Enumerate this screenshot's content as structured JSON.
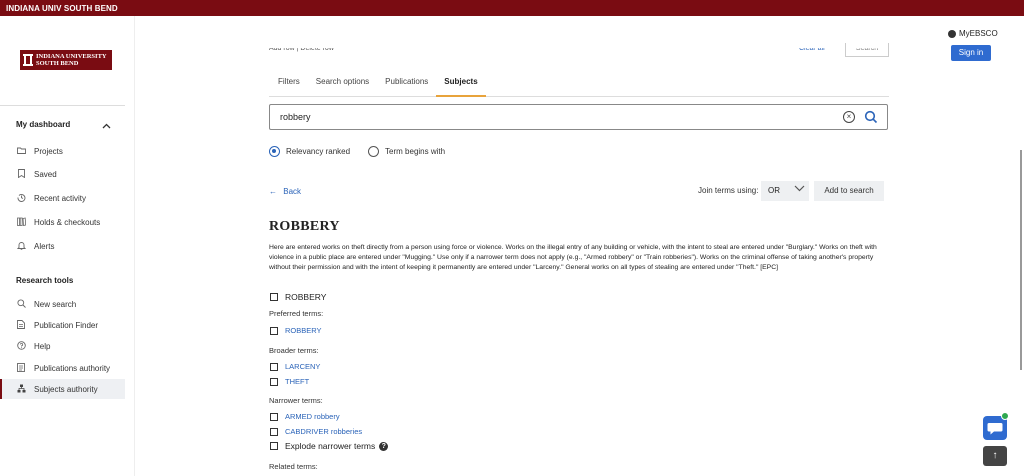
{
  "topbar": {
    "title": "INDIANA UNIV SOUTH BEND"
  },
  "logo": {
    "line1": "INDIANA UNIVERSITY",
    "line2": "SOUTH BEND"
  },
  "sidebar": {
    "dashboard_label": "My dashboard",
    "items": [
      {
        "label": "Projects",
        "icon": "folder-icon"
      },
      {
        "label": "Saved",
        "icon": "bookmark-icon"
      },
      {
        "label": "Recent activity",
        "icon": "history-icon"
      },
      {
        "label": "Holds & checkouts",
        "icon": "books-icon"
      },
      {
        "label": "Alerts",
        "icon": "bell-icon"
      }
    ],
    "research_label": "Research tools",
    "tools": [
      {
        "label": "New search",
        "icon": "search-icon"
      },
      {
        "label": "Publication Finder",
        "icon": "document-icon"
      },
      {
        "label": "Help",
        "icon": "help-icon"
      },
      {
        "label": "Publications authority",
        "icon": "list-icon"
      },
      {
        "label": "Subjects authority",
        "icon": "hierarchy-icon"
      }
    ]
  },
  "ghost": {
    "add_row": "Add row",
    "delete_row": "Delete row",
    "clear_all": "Clear all",
    "search": "Search"
  },
  "tabs": [
    "Filters",
    "Search options",
    "Publications",
    "Subjects"
  ],
  "search": {
    "value": "robbery"
  },
  "radios": {
    "relevancy": "Relevancy ranked",
    "begins": "Term begins with"
  },
  "nav": {
    "back": "Back",
    "join_label": "Join terms using:",
    "join_value": "OR",
    "add_to_search": "Add to search"
  },
  "subject": {
    "heading": "ROBBERY",
    "description": "Here are entered works on theft directly from a person using force or violence. Works on the illegal entry of any building or vehicle, with the intent to steal are entered under \"Burglary.\" Works on theft with violence in a public place are entered under \"Mugging.\" Use only if a narrower term does not apply (e.g., \"Armed robbery\" or \"Train robberies\"). Works on the criminal offense of taking another's property without their permission and with the intent of keeping it permanently are entered under \"Larceny.\" General works on all types of stealing are entered under \"Theft.\" [EPC]",
    "term": "ROBBERY",
    "preferred_label": "Preferred terms:",
    "preferred": [
      "ROBBERY"
    ],
    "broader_label": "Broader terms:",
    "broader": [
      "LARCENY",
      "THEFT"
    ],
    "narrower_label": "Narrower terms:",
    "narrower": [
      "ARMED robbery",
      "CABDRIVER robberies"
    ],
    "explode_label": "Explode narrower terms",
    "related_label": "Related terms:"
  },
  "account": {
    "myebsco": "MyEBSCO",
    "signin": "Sign in"
  }
}
